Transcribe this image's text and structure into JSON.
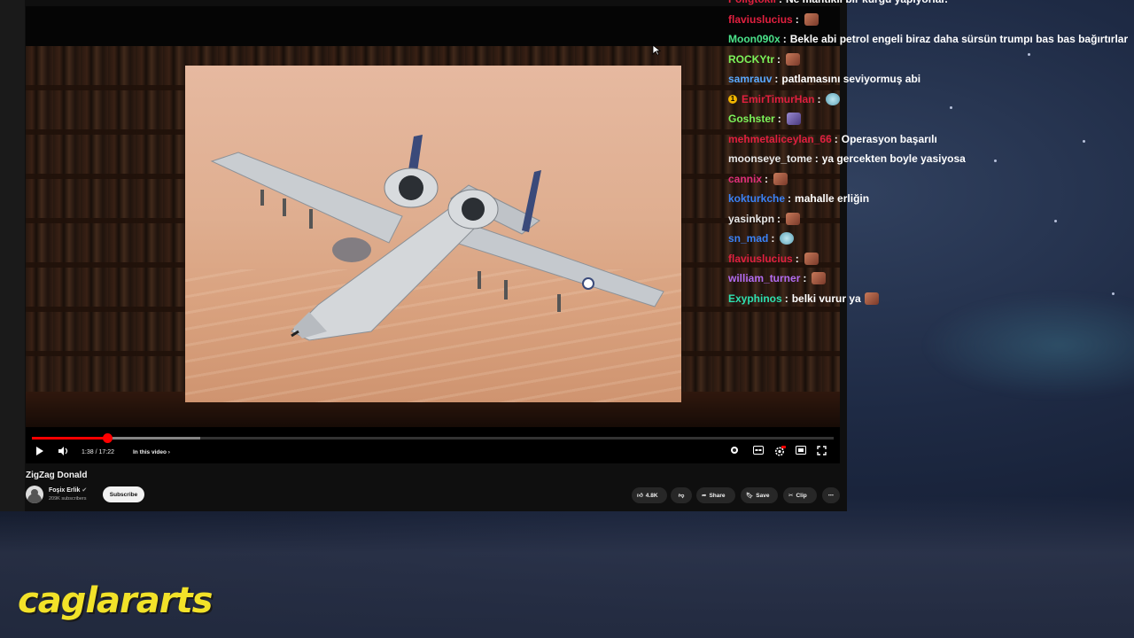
{
  "video": {
    "time": "1:38 / 17:22",
    "chapter": "In this video",
    "progress_fraction": 0.094,
    "buffered_fraction": 0.21
  },
  "meta": {
    "title": "ZigZag Donald",
    "channel": "Foşix Erlik",
    "subscribers": "209K subscribers",
    "subscribe_label": "Subscribe",
    "likes": "4.8K",
    "share_label": "Share",
    "save_label": "Save",
    "clip_label": "Clip"
  },
  "chat": [
    {
      "name": "Poligtokil",
      "name_color": "#e0203f",
      "text": "Ne mantıklı bir kurgu yapıyorlar.",
      "emote": null
    },
    {
      "name": "flaviuslucius",
      "name_color": "#e0203f",
      "text": "",
      "emote": "brick"
    },
    {
      "name": "Moon090x",
      "name_color": "#4be38a",
      "text": "Bekle abi petrol engeli biraz daha sürsün trumpı bas bas bağırtırlar",
      "emote": null
    },
    {
      "name": "ROCKYtr",
      "name_color": "#7cf35a",
      "text": "",
      "emote": "brick"
    },
    {
      "name": "samrauv",
      "name_color": "#5aa9ff",
      "text": "patlamasını seviyormuş abi",
      "emote": null
    },
    {
      "name": "EmirTimurHan",
      "name_color": "#e0203f",
      "text": "",
      "emote": "blue",
      "badge": "1"
    },
    {
      "name": "Goshster",
      "name_color": "#7cf35a",
      "text": "",
      "emote": "purple"
    },
    {
      "name": "mehmetaliceylan_66",
      "name_color": "#e0203f",
      "text": "Operasyon başarılı",
      "emote": null
    },
    {
      "name": "moonseye_tome",
      "name_color": "#e8e8e8",
      "text": "ya gercekten boyle yasiyosa",
      "emote": null
    },
    {
      "name": "cannix",
      "name_color": "#e0307a",
      "text": "",
      "emote": "brick"
    },
    {
      "name": "kokturkche",
      "name_color": "#3b82f6",
      "text": "mahalle erliğin",
      "emote": null
    },
    {
      "name": "yasinkpn",
      "name_color": "#e8e8e8",
      "text": "",
      "emote": "brick"
    },
    {
      "name": "sn_mad",
      "name_color": "#3b82f6",
      "text": "",
      "emote": "blue"
    },
    {
      "name": "flaviuslucius",
      "name_color": "#e0203f",
      "text": "",
      "emote": "brick"
    },
    {
      "name": "william_turner",
      "name_color": "#b36cf0",
      "text": "",
      "emote": "face"
    },
    {
      "name": "Exyphinos",
      "name_color": "#2ee0b0",
      "text": "belki vurur ya",
      "emote": "brick"
    }
  ],
  "watermark": "caglararts"
}
